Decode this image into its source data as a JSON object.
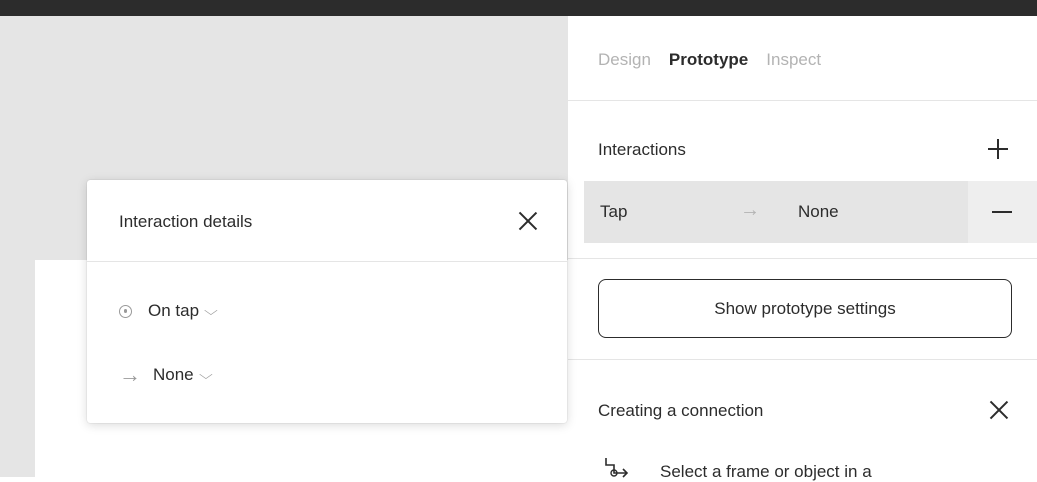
{
  "tabs": [
    {
      "label": "Design",
      "active": false
    },
    {
      "label": "Prototype",
      "active": true
    },
    {
      "label": "Inspect",
      "active": false
    }
  ],
  "interactions": {
    "title": "Interactions",
    "add_icon": "plus-icon",
    "remove_icon": "minus-icon",
    "rows": [
      {
        "trigger": "Tap",
        "arrow": "→",
        "destination": "None"
      }
    ]
  },
  "prototype_settings_button": "Show prototype settings",
  "creating_connection": {
    "title": "Creating a connection",
    "close_icon": "close-icon",
    "description": "Select a frame or object in a"
  },
  "interaction_details": {
    "title": "Interaction details",
    "close_icon": "close-icon",
    "trigger_label": "On tap",
    "trigger_icon": "trigger-target-icon",
    "action_arrow": "→",
    "action_label": "None",
    "chevron": "⌵"
  },
  "colors": {
    "topbar": "#2c2c2c",
    "canvas": "#e5e5e5",
    "text": "#2c2c2c",
    "muted": "#b3b3b3"
  }
}
